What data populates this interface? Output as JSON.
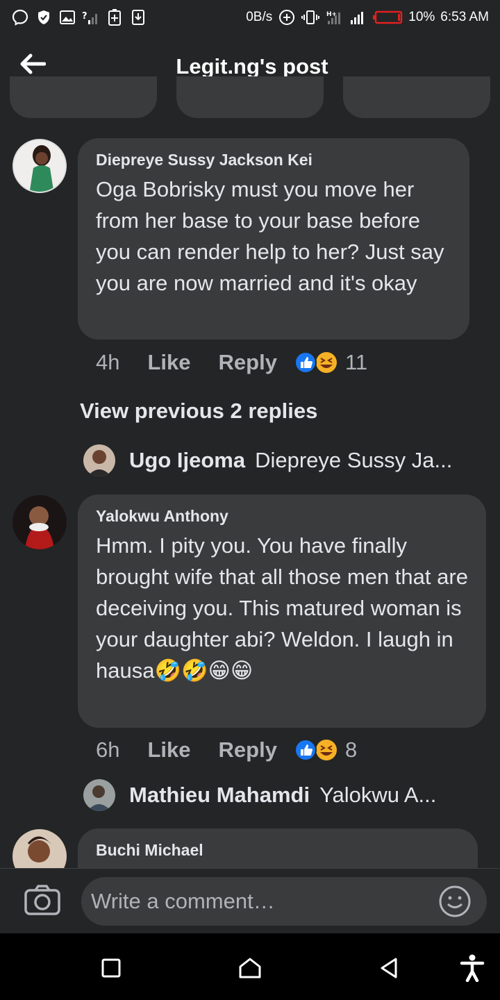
{
  "status_bar": {
    "net_speed": "0B/s",
    "battery_percent": "10%",
    "time": "6:53 AM",
    "icons": [
      "messenger-icon",
      "shield-icon",
      "image-icon",
      "signal-question-icon",
      "battery-plus-icon",
      "download-icon",
      "add-circle-icon",
      "vibrate-icon",
      "signal-icon",
      "battery-low-icon"
    ]
  },
  "header": {
    "title": "Legit.ng's post",
    "back_icon": "arrow-left-icon"
  },
  "comments": [
    {
      "author": "Diepreye Sussy Jackson Kei",
      "text": "Oga Bobrisky must you move her from her base to your base before you can render help to her? Just say you are now married and it's okay",
      "time": "4h",
      "like_label": "Like",
      "reply_label": "Reply",
      "reaction_count": "11"
    },
    {
      "author": "Yalokwu Anthony",
      "text": "Hmm. I pity you. You have finally brought wife that all those men that are deceiving you. This matured woman is your daughter abi? Weldon. I laugh in hausa🤣🤣😁😁",
      "time": "6h",
      "like_label": "Like",
      "reply_label": "Reply",
      "reaction_count": "8"
    },
    {
      "author": "Buchi Michael"
    }
  ],
  "view_previous": "View previous 2 replies",
  "replies": [
    {
      "name": "Ugo Ijeoma",
      "preview": "Diepreye Sussy Ja..."
    },
    {
      "name": "Mathieu Mahamdi",
      "preview": "Yalokwu A..."
    }
  ],
  "composer": {
    "placeholder": "Write a comment…"
  },
  "colors": {
    "background": "#242526",
    "bubble": "#3a3b3c",
    "like_blue": "#1877f2",
    "haha_yellow": "#f7b125",
    "battery_red": "#e02020"
  }
}
